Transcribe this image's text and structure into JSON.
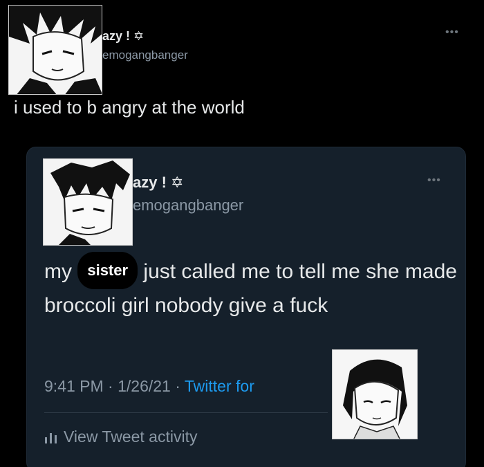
{
  "outer_tweet": {
    "display_name": "azy ! ✡",
    "handle": "emogangbanger",
    "text": "i used to b angry at the world",
    "more_icon": "more-horizontal-icon",
    "more_glyph": "•••"
  },
  "quoted_tweet": {
    "display_name": "azy ! ✡",
    "handle": "emogangbanger",
    "more_glyph": "•••",
    "text_before": "my",
    "redacted_word": "sister",
    "text_after": "just called me to tell me she made broccoli girl nobody give a fuck",
    "time": "9:41 PM",
    "separator": "·",
    "date": "1/26/21",
    "source": "Twitter for",
    "activity_label": "View Tweet activity",
    "activity_icon": "bar-chart-icon"
  },
  "colors": {
    "background": "#000000",
    "card": "#15202b",
    "text": "#e7e9ea",
    "muted": "#8b98a5",
    "link": "#1d9bf0"
  }
}
